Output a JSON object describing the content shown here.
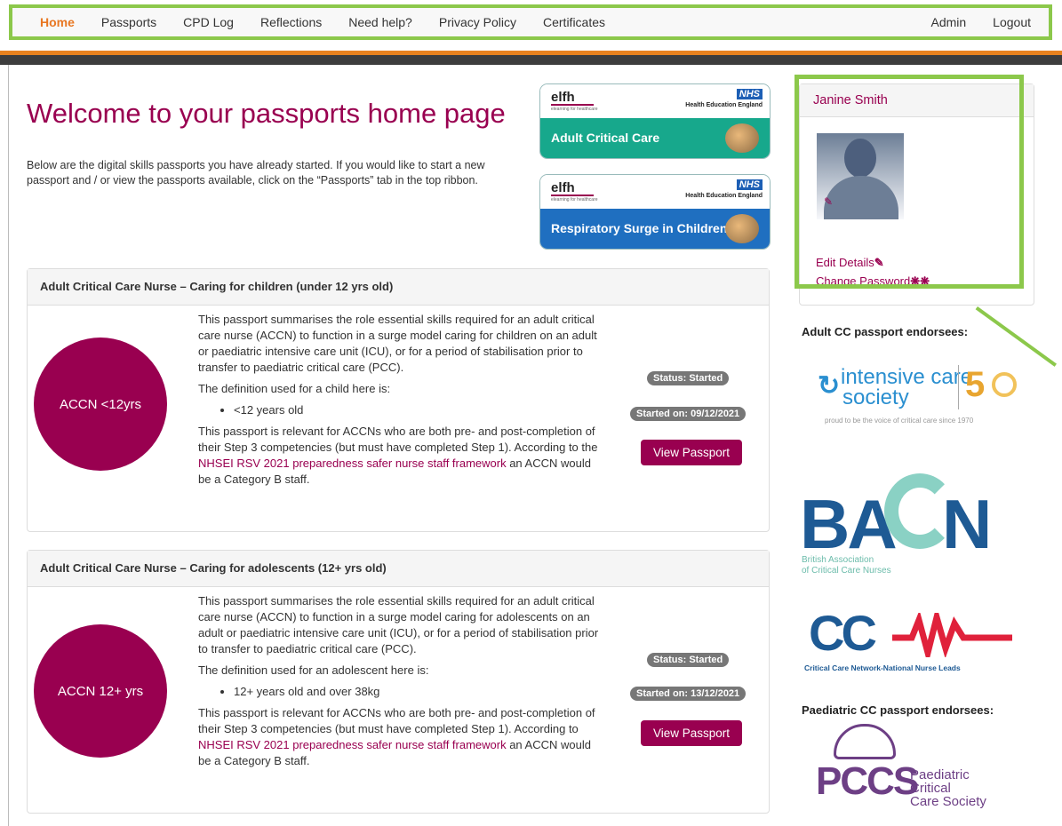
{
  "nav": {
    "items": [
      "Home",
      "Passports",
      "CPD Log",
      "Reflections",
      "Need help?",
      "Privacy Policy",
      "Certificates"
    ],
    "right": [
      "Admin",
      "Logout"
    ]
  },
  "page": {
    "title": "Welcome to your passports home page",
    "intro": "Below are the digital skills passports you have already started. If you would like to start a new passport and / or view the passports available, click on the “Passports” tab in the top ribbon."
  },
  "banners": [
    {
      "elfh": "elfh",
      "elfh_sub": "elearning for healthcare",
      "nhs": "NHS",
      "hee": "Health Education England",
      "label": "Adult Critical Care"
    },
    {
      "elfh": "elfh",
      "elfh_sub": "elearning for healthcare",
      "nhs": "NHS",
      "hee": "Health Education England",
      "label": "Respiratory Surge in Children"
    }
  ],
  "passports": [
    {
      "header": "Adult Critical Care Nurse – Caring for children (under 12 yrs old)",
      "circle": "ACCN <12yrs",
      "p1": "This passport summarises the role essential skills required for an adult critical care nurse (ACCN) to function in a surge model caring for children on an adult or paediatric intensive care unit (ICU), or for a period of stabilisation prior to transfer to paediatric critical care (PCC).",
      "p2": "The definition used for a child here is:",
      "bullet": "<12 years old",
      "p3_pre": "This passport is relevant for ACCNs who are both pre- and post-completion of their Step 3 competencies (but must have completed Step 1). According to the ",
      "p3_link": "NHSEI RSV 2021 preparedness safer nurse staff framework",
      "p3_post": " an ACCN would be a Category B staff.",
      "status": "Status: Started",
      "started": "Started on: 09/12/2021",
      "button": "View Passport"
    },
    {
      "header": "Adult Critical Care Nurse – Caring for adolescents (12+ yrs old)",
      "circle": "ACCN 12+ yrs",
      "p1": "This passport summarises the role essential skills required for an adult critical care nurse (ACCN) to function in a surge model caring for adolescents on an adult or paediatric intensive care unit (ICU), or for a period of stabilisation prior to transfer to paediatric critical care (PCC).",
      "p2": "The definition used for an adolescent here is:",
      "bullet": "12+ years old and over 38kg",
      "p3_pre": "This passport is relevant for ACCNs who are both pre- and post-completion of their Step 3 competencies (but must have completed Step 1). According to ",
      "p3_link": "NHSEI RSV 2021 preparedness safer nurse staff framework",
      "p3_post": " an ACCN would be a Category B staff.",
      "status": "Status: Started",
      "started": "Started on: 13/12/2021",
      "button": "View Passport"
    }
  ],
  "profile": {
    "name": "Janine Smith",
    "edit": "Edit Details",
    "change_password": "Change Password",
    "pen_icon": "✎",
    "key_icon": "❋❋"
  },
  "endorsees": {
    "adult_title": "Adult CC passport endorsees:",
    "paed_title": "Paediatric CC passport endorsees:",
    "ics": {
      "line1": "intensive care",
      "line2": "society",
      "fifty": "5",
      "tagline": "proud to be the voice of critical care since 1970"
    },
    "bacn": {
      "ba": "BA",
      "cn": "N",
      "sub1": "British Association",
      "sub2": "of Critical Care Nurses"
    },
    "ccn": {
      "mark": "CC",
      "sub": "Critical Care Network-National Nurse Leads"
    },
    "pccs": {
      "mark": "PCCS",
      "line1": "Paediatric Critical",
      "line2": "Care Society"
    }
  }
}
